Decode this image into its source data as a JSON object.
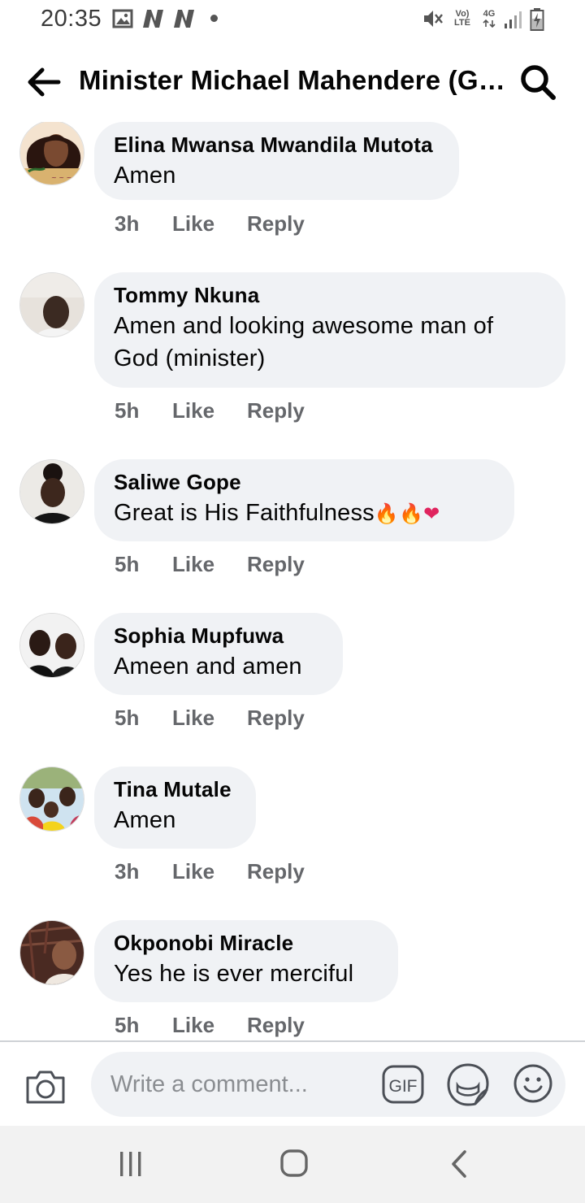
{
  "status_bar": {
    "time": "20:35",
    "volte": "Vo) LTE",
    "network": "4G",
    "icons": [
      "gallery-icon",
      "n-notification-icon",
      "n-notification-icon",
      "dot-icon",
      "mute-icon",
      "volte-icon",
      "4g-icon",
      "signal-icon",
      "battery-charging-icon"
    ]
  },
  "header": {
    "title": "Minister Michael Mahendere (GP...",
    "back_icon": "arrow-left-icon",
    "search_icon": "search-icon"
  },
  "comments": [
    {
      "author": "Elina Mwansa Mwandila Mutota",
      "text": "Amen",
      "time": "3h",
      "like": "Like",
      "reply": "Reply"
    },
    {
      "author": "Tommy Nkuna",
      "text_lines": [
        "Amen and looking awesome man of",
        "God (minister)"
      ],
      "time": "5h",
      "like": "Like",
      "reply": "Reply"
    },
    {
      "author": "Saliwe Gope",
      "text": "Great is His Faithfulness",
      "emojis": [
        "🔥",
        "🔥",
        "❤"
      ],
      "time": "5h",
      "like": "Like",
      "reply": "Reply"
    },
    {
      "author": "Sophia Mupfuwa",
      "text": "Ameen and amen",
      "time": "5h",
      "like": "Like",
      "reply": "Reply"
    },
    {
      "author": "Tina Mutale",
      "text": "Amen",
      "time": "3h",
      "like": "Like",
      "reply": "Reply"
    },
    {
      "author": "Okponobi Miracle",
      "text": "Yes he is ever merciful",
      "time": "5h",
      "like": "Like",
      "reply": "Reply"
    }
  ],
  "composer": {
    "placeholder": "Write a comment...",
    "gif_label": "GIF",
    "icons": [
      "camera-icon",
      "gif-icon",
      "sticker-icon",
      "emoji-icon"
    ]
  },
  "android_nav": {
    "icons": [
      "recent-apps-icon",
      "home-icon",
      "back-icon"
    ]
  },
  "colors": {
    "bubble": "#f0f2f5",
    "meta_text": "#65676b",
    "text": "#050505"
  }
}
